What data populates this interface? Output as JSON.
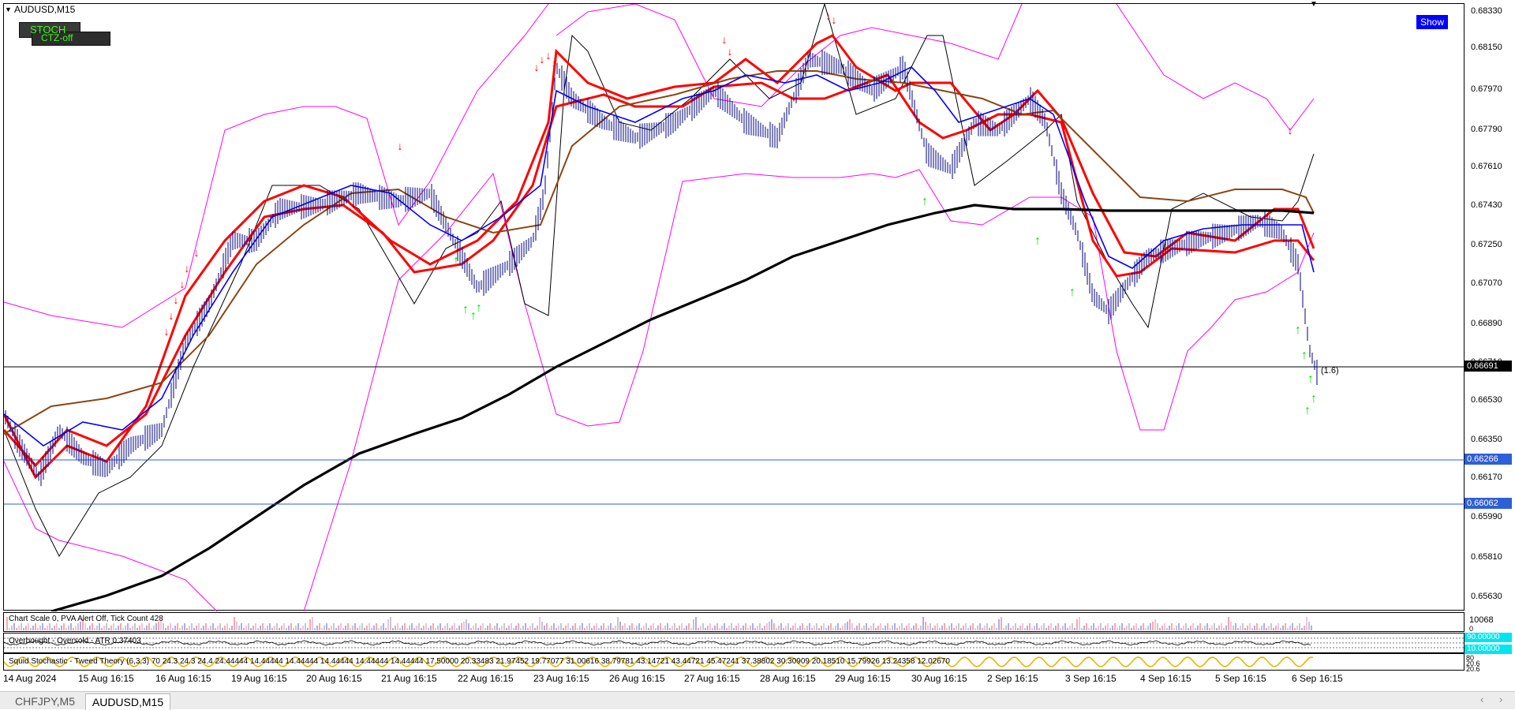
{
  "window": {
    "symbol_title": "AUDUSD,M15",
    "indicator_stoch_label": "STOCH",
    "indicator_ctz_label": "CTZ-off",
    "show_button": "Show"
  },
  "price_axis": {
    "ticks": [
      "0.68330",
      "0.68150",
      "0.67970",
      "0.67790",
      "0.67610",
      "0.67430",
      "0.67250",
      "0.67070",
      "0.66890",
      "0.66710",
      "0.66530",
      "0.66350",
      "0.66170",
      "0.65990",
      "0.65810",
      "0.65630"
    ],
    "current_price": "0.66691",
    "level_1": "0.66266",
    "level_2": "0.66062",
    "current_annotation": "(1.6)"
  },
  "volume_panel": {
    "info": "Chart Scale  0,   PVA Alert Off,   Tick Count  428",
    "max_label": "10068",
    "zero_label": "0"
  },
  "osc_panel": {
    "label": "Overbought - Oversold - ATR 0.37403",
    "level_top": "90.00000",
    "level_bottom": "10.00000"
  },
  "stoch_panel": {
    "label": "Squid Stochastic - Tweed Theory (6,3,3) 70 24.3 24.3 24.4 24.44444 14.44444 14.44444 14.44444 14.44444 14.44444 17.50000 20.33483 21.97452 19.77077 31.00616 38.79781 43.14721 43.44721 45.47241 37.38802 30.30909 20.18510 15.79926 13.24358 12.02670",
    "level_top": "80",
    "level_mid": "20.6",
    "level_bottom": "20.6"
  },
  "time_axis": [
    "14 Aug 2024",
    "15 Aug 16:15",
    "16 Aug 16:15",
    "19 Aug 16:15",
    "20 Aug 16:15",
    "21 Aug 16:15",
    "22 Aug 16:15",
    "23 Aug 16:15",
    "26 Aug 16:15",
    "27 Aug 16:15",
    "28 Aug 16:15",
    "29 Aug 16:15",
    "30 Aug 16:15",
    "2 Sep 16:15",
    "3 Sep 16:15",
    "4 Sep 16:15",
    "5 Sep 16:15",
    "6 Sep 16:15"
  ],
  "tabs": [
    {
      "label": "CHFJPY,M5",
      "active": false
    },
    {
      "label": "AUDUSD,M15",
      "active": true
    }
  ],
  "colors": {
    "accent_show": "#0000ff",
    "line_red": "#ff0000",
    "line_magenta": "#ff00ff",
    "line_blue": "#0000ff",
    "line_brown": "#8b4513",
    "arrow_green": "#00ff00",
    "candle_navy": "#000080"
  },
  "icons": {
    "menu": "triangle-down-icon",
    "scroll_left": "chevron-left-icon",
    "scroll_right": "chevron-right-icon"
  }
}
